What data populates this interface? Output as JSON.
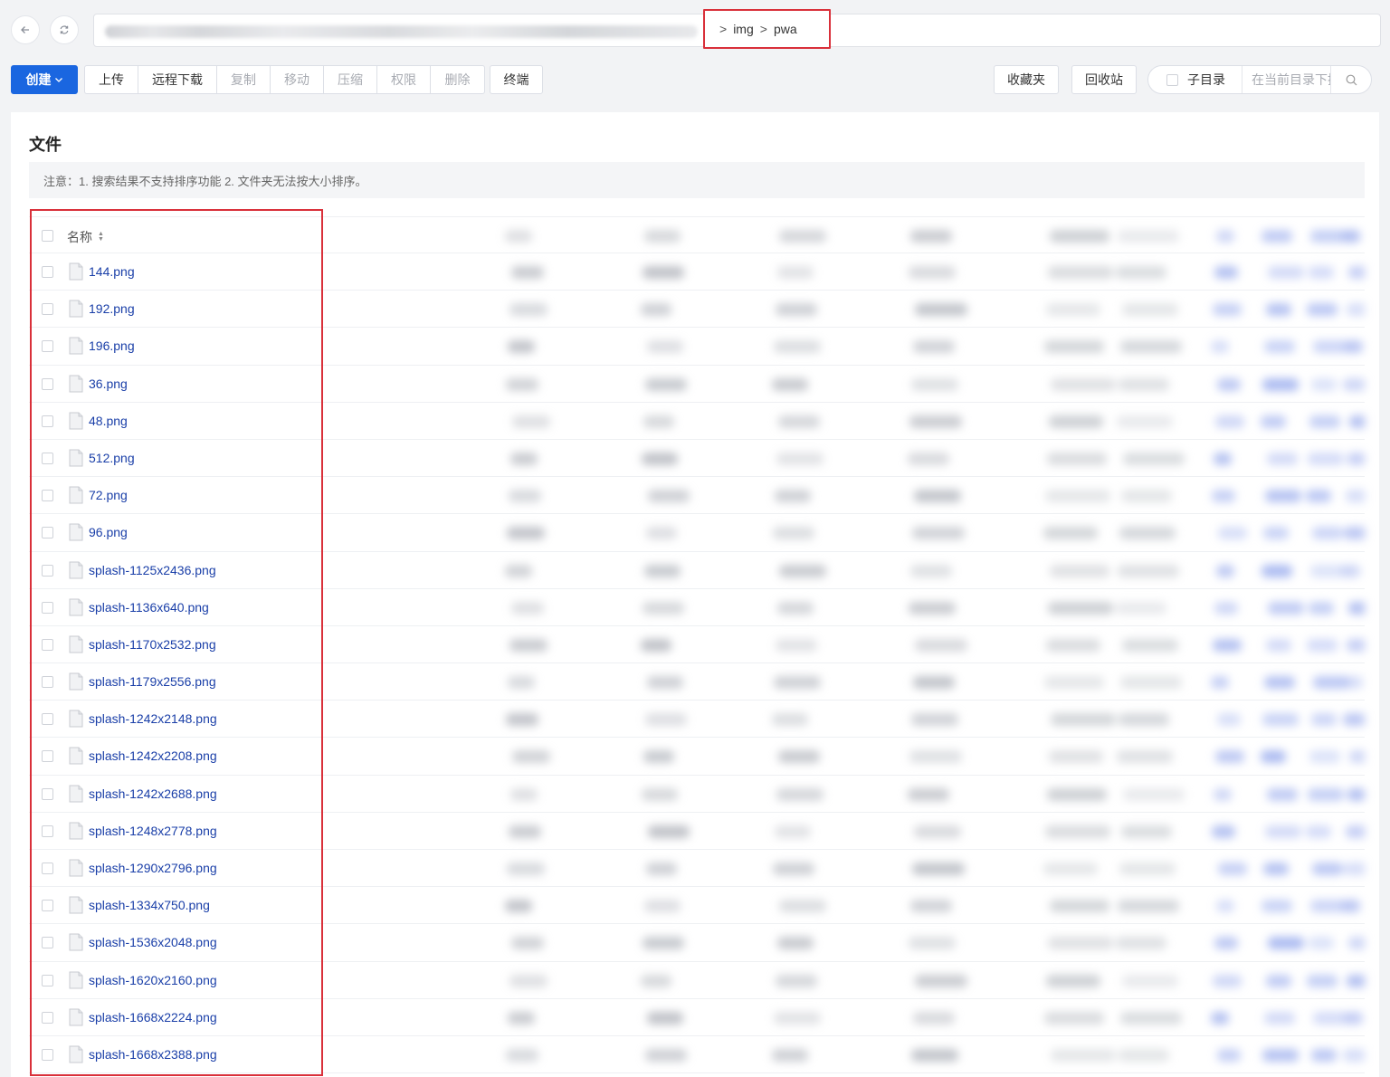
{
  "nav": {
    "back_icon": "arrow-left-icon",
    "refresh_icon": "refresh-icon",
    "breadcrumb": [
      "img",
      "pwa"
    ],
    "breadcrumb_separator": ">"
  },
  "toolbar": {
    "create": "创建",
    "upload": "上传",
    "remote_download": "远程下载",
    "copy": "复制",
    "move": "移动",
    "compress": "压缩",
    "permissions": "权限",
    "delete": "删除",
    "terminal": "终端",
    "favorites": "收藏夹",
    "recycle_bin": "回收站",
    "subdir_label": "子目录",
    "search_placeholder": "在当前目录下搜索"
  },
  "panel": {
    "title": "文件",
    "notice": "注意：1. 搜索结果不支持排序功能 2. 文件夹无法按大小排序。"
  },
  "table": {
    "name_header": "名称",
    "files": [
      "144.png",
      "192.png",
      "196.png",
      "36.png",
      "48.png",
      "512.png",
      "72.png",
      "96.png",
      "splash-1125x2436.png",
      "splash-1136x640.png",
      "splash-1170x2532.png",
      "splash-1179x2556.png",
      "splash-1242x2148.png",
      "splash-1242x2208.png",
      "splash-1242x2688.png",
      "splash-1248x2778.png",
      "splash-1290x2796.png",
      "splash-1334x750.png",
      "splash-1536x2048.png",
      "splash-1620x2160.png",
      "splash-1668x2224.png",
      "splash-1668x2388.png"
    ]
  },
  "colors": {
    "primary": "#1a66e0",
    "link": "#1a3fa8",
    "highlight": "#d9303a"
  }
}
